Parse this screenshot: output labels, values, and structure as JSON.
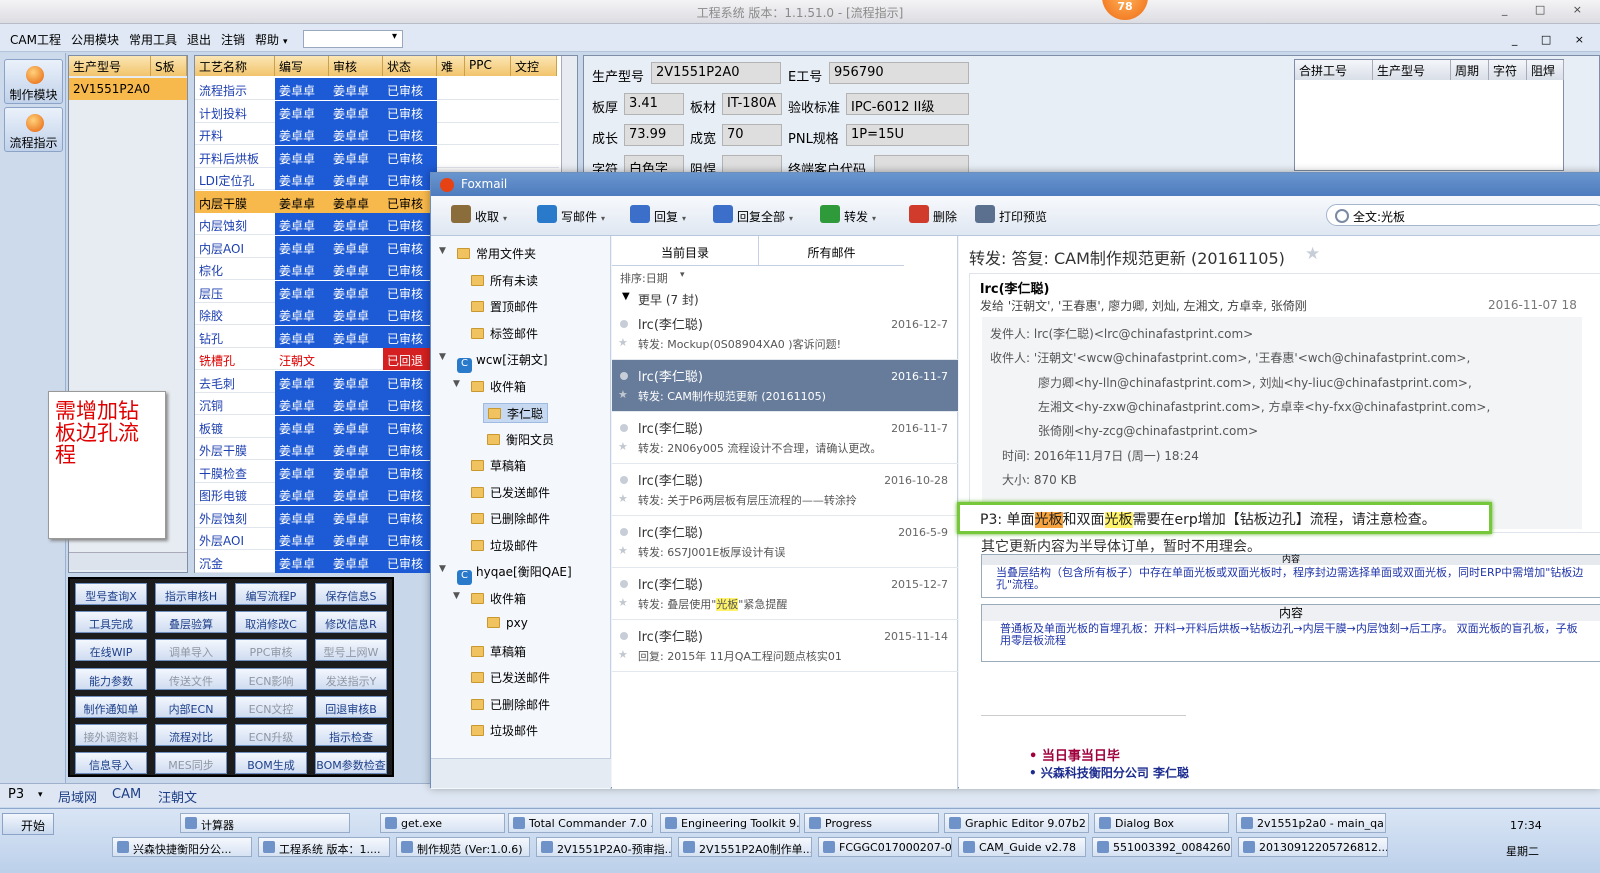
{
  "app": {
    "title": "工程系统  版本：1.1.51.0 - [流程指示]",
    "badge": "78",
    "window_controls": [
      "_",
      "□",
      "×"
    ]
  },
  "menubar": {
    "items": [
      "CAM工程",
      "公用模块",
      "常用工具",
      "退出",
      "注销",
      "帮助"
    ],
    "dropdown_value": ""
  },
  "leftbar": {
    "buttons": [
      "制作模块",
      "流程指示"
    ]
  },
  "model_grid": {
    "headers": [
      "生产型号",
      "S板"
    ],
    "rows": [
      [
        "2V1551P2A0",
        ""
      ]
    ]
  },
  "process_grid": {
    "headers": [
      "工艺名称",
      "编写",
      "审核",
      "状态",
      "难",
      "PPC",
      "文控"
    ],
    "rows": [
      {
        "name": "流程指示",
        "writer": "姜卓卓",
        "reviewer": "姜卓卓",
        "status": "已审核"
      },
      {
        "name": "计划投料",
        "writer": "姜卓卓",
        "reviewer": "姜卓卓",
        "status": "已审核"
      },
      {
        "name": "开料",
        "writer": "姜卓卓",
        "reviewer": "姜卓卓",
        "status": "已审核"
      },
      {
        "name": "开料后烘板",
        "writer": "姜卓卓",
        "reviewer": "姜卓卓",
        "status": "已审核"
      },
      {
        "name": "LDI定位孔",
        "writer": "姜卓卓",
        "reviewer": "姜卓卓",
        "status": "已审核"
      },
      {
        "name": "内层干膜",
        "writer": "姜卓卓",
        "reviewer": "姜卓卓",
        "status": "已审核"
      },
      {
        "name": "内层蚀刻",
        "writer": "姜卓卓",
        "reviewer": "姜卓卓",
        "status": "已审核"
      },
      {
        "name": "内层AOI",
        "writer": "姜卓卓",
        "reviewer": "姜卓卓",
        "status": "已审核"
      },
      {
        "name": "棕化",
        "writer": "姜卓卓",
        "reviewer": "姜卓卓",
        "status": "已审核"
      },
      {
        "name": "层压",
        "writer": "姜卓卓",
        "reviewer": "姜卓卓",
        "status": "已审核"
      },
      {
        "name": "除胶",
        "writer": "姜卓卓",
        "reviewer": "姜卓卓",
        "status": "已审核"
      },
      {
        "name": "钻孔",
        "writer": "姜卓卓",
        "reviewer": "姜卓卓",
        "status": "已审核"
      },
      {
        "name": "铣槽孔",
        "writer": "汪朝文",
        "reviewer": "",
        "status": "已回退"
      },
      {
        "name": "去毛刺",
        "writer": "姜卓卓",
        "reviewer": "姜卓卓",
        "status": "已审核"
      },
      {
        "name": "沉铜",
        "writer": "姜卓卓",
        "reviewer": "姜卓卓",
        "status": "已审核"
      },
      {
        "name": "板镀",
        "writer": "姜卓卓",
        "reviewer": "姜卓卓",
        "status": "已审核"
      },
      {
        "name": "外层干膜",
        "writer": "姜卓卓",
        "reviewer": "姜卓卓",
        "status": "已审核"
      },
      {
        "name": "干膜检查",
        "writer": "姜卓卓",
        "reviewer": "姜卓卓",
        "status": "已审核"
      },
      {
        "name": "图形电镀",
        "writer": "姜卓卓",
        "reviewer": "姜卓卓",
        "status": "已审核"
      },
      {
        "name": "外层蚀刻",
        "writer": "姜卓卓",
        "reviewer": "姜卓卓",
        "status": "已审核"
      },
      {
        "name": "外层AOI",
        "writer": "姜卓卓",
        "reviewer": "姜卓卓",
        "status": "已审核"
      },
      {
        "name": "沉金",
        "writer": "姜卓卓",
        "reviewer": "姜卓卓",
        "status": "已审核"
      }
    ]
  },
  "sticky_note": "需增加钻板边孔流程",
  "function_buttons": [
    [
      "型号查询X",
      "指示审核H",
      "编写流程P",
      "保存信息S"
    ],
    [
      "工具完成",
      "叠层验算",
      "取消修改C",
      "修改信息R"
    ],
    [
      "在线WIP",
      "调单导入",
      "PPC审核",
      "型号上网W"
    ],
    [
      "能力参数",
      "传送文件",
      "ECN影响",
      "发送指示Y"
    ],
    [
      "制作通知单",
      "内部ECN",
      "ECN文控",
      "回退审核B"
    ],
    [
      "接外调资料",
      "流程对比",
      "ECN升级",
      "指示检查"
    ],
    [
      "信息导入",
      "MES同步",
      "BOM生成",
      "BOM参数检查"
    ]
  ],
  "info": {
    "labels": [
      "生产型号",
      "E工号",
      "板厚",
      "板材",
      "验收标准",
      "成长",
      "成宽",
      "PNL规格",
      "字符",
      "阻焊",
      "终端客户代码"
    ],
    "values": {
      "model": "2V1551P2A0",
      "eid": "956790",
      "thickness": "3.41",
      "material": "IT-180A",
      "standard": "IPC-6012 II级",
      "len": "73.99",
      "wid": "70",
      "pnl": "1P=15U",
      "char": "白色字符"
    }
  },
  "merge_grid": {
    "headers": [
      "合拼工号",
      "生产型号",
      "周期",
      "字符",
      "阻焊"
    ]
  },
  "statusbar": {
    "items": [
      "P3",
      "局域网",
      "CAM",
      "汪朝文"
    ]
  },
  "foxmail": {
    "title": "Foxmail",
    "toolbar": [
      "收取",
      "写邮件",
      "回复",
      "回复全部",
      "转发",
      "删除",
      "打印预览"
    ],
    "search_value": "全文:光板",
    "folders": [
      {
        "label": "常用文件夹",
        "level": 0,
        "expander": "▼"
      },
      {
        "label": "所有未读",
        "level": 1
      },
      {
        "label": "置顶邮件",
        "level": 1
      },
      {
        "label": "标签邮件",
        "level": 1
      },
      {
        "label": "wcw[汪朝文]",
        "level": 0,
        "expander": "▼",
        "account": true
      },
      {
        "label": "收件箱",
        "level": 1,
        "expander": "▼"
      },
      {
        "label": "李仁聪",
        "level": 2,
        "selected": true
      },
      {
        "label": "衡阳文员",
        "level": 2
      },
      {
        "label": "草稿箱",
        "level": 1
      },
      {
        "label": "已发送邮件",
        "level": 1
      },
      {
        "label": "已删除邮件",
        "level": 1
      },
      {
        "label": "垃圾邮件",
        "level": 1
      },
      {
        "label": "hyqae[衡阳QAE]",
        "level": 0,
        "expander": "▼",
        "account": true
      },
      {
        "label": "收件箱",
        "level": 1,
        "expander": "▼"
      },
      {
        "label": "pxy",
        "level": 2
      },
      {
        "label": "草稿箱",
        "level": 1
      },
      {
        "label": "已发送邮件",
        "level": 1
      },
      {
        "label": "已删除邮件",
        "level": 1
      },
      {
        "label": "垃圾邮件",
        "level": 1
      }
    ],
    "list_tabs": [
      "当前目录",
      "所有邮件"
    ],
    "sort_label": "排序:日期",
    "group_label": "更早 (7 封)",
    "mails": [
      {
        "from": "lrc(李仁聪)",
        "date": "2016-12-7",
        "subject": "转发: Mockup(0S08904XA0 )客诉问题!"
      },
      {
        "from": "lrc(李仁聪)",
        "date": "2016-11-7",
        "subject": "转发: CAM制作规范更新 (20161105)",
        "selected": true
      },
      {
        "from": "lrc(李仁聪)",
        "date": "2016-11-7",
        "subject": "转发: 2N06y005 流程设计不合理，请确认更改。"
      },
      {
        "from": "lrc(李仁聪)",
        "date": "2016-10-28",
        "subject": "转发: 关于P6两层板有层压流程的——转涂拎"
      },
      {
        "from": "lrc(李仁聪)",
        "date": "2016-5-9",
        "subject": "转发: 6S7J001E板厚设计有误"
      },
      {
        "from": "lrc(李仁聪)",
        "date": "2015-12-7",
        "subject_pre": "转发: 叠层使用\"",
        "subject_hl": "光板",
        "subject_post": "\"紧急提醒"
      },
      {
        "from": "lrc(李仁聪)",
        "date": "2015-11-14",
        "subject": "回复: 2015年 11月QA工程问题点核实01"
      }
    ],
    "preview": {
      "subject": "转发: 答复: CAM制作规范更新 (20161105)",
      "sender": "lrc(李仁聪)",
      "send_line": "发给 '汪朝文', '王春惠', 廖力卿, 刘灿, 左湘文, 方卓幸, 张倚刚",
      "send_date": "2016-11-07 18",
      "from_line": "发件人: lrc(李仁聪)<lrc@chinafastprint.com>",
      "to_lines": [
        "收件人: '汪朝文'<wcw@chinafastprint.com>, '王春惠'<wch@chinafastprint.com>,",
        "廖力卿<hy-lln@chinafastprint.com>, 刘灿<hy-liuc@chinafastprint.com>,",
        "左湘文<hy-zxw@chinafastprint.com>, 方卓幸<hy-fxx@chinafastprint.com>,",
        "张倚刚<hy-zcg@chinafastprint.com>"
      ],
      "time_line": "时间: 2016年11月7日 (周一) 18:24",
      "size_line": "大小: 870 KB",
      "callout": {
        "pre": "P3: 单面",
        "hl1": "光板",
        "mid": "和双面",
        "hl2": "光板",
        "post": "需要在erp增加【钻板边孔】流程，请注意检查。"
      },
      "body_line": "其它更新内容为半导体订单，暂时不用理会。",
      "table1_header": "内容",
      "table1_text": "当叠层结构（包含所有板子）中存在单面光板或双面光板时，程序封边需选择单面或双面光板，同时ERP中需增加\"钻板边孔\"流程。",
      "table2_header": "内容",
      "table2_text": "普通板及单面光板的盲埋孔板：开料→开料后烘板→钻板边孔→内层干膜→内层蚀刻→后工序。  双面光板的盲孔板，子板用零层板流程",
      "sig": [
        "当日事当日毕",
        "兴森科技衡阳分公司   李仁聪"
      ]
    }
  },
  "taskbar": {
    "start": "开始",
    "row1": [
      "计算器",
      "get.exe",
      "Total Commander 7.0 ...",
      "Engineering Toolkit 9....",
      "Progress",
      "Graphic Editor 9.07b2 ...",
      "Dialog Box",
      "2v1551p2a0 - main_qa"
    ],
    "row2": [
      "兴森快捷衡阳分公...",
      "工程系统  版本：1....",
      "制作规范 (Ver:1.0.6)",
      "2V1551P2A0-预审指...",
      "2V1551P2A0制作单....",
      "FCGGC017000207-0...",
      "CAM_Guide v2.78",
      "551003392_0084260...",
      "20130912205726812..."
    ],
    "clock": "17:34",
    "weekday": "星期二"
  }
}
